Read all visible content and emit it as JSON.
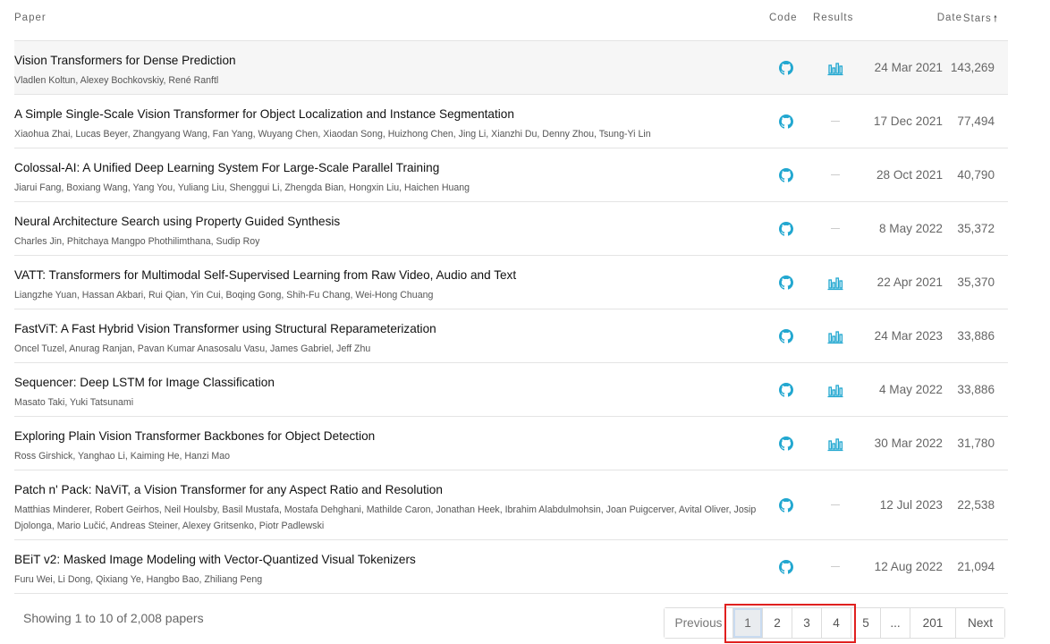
{
  "header": {
    "paper": "Paper",
    "code": "Code",
    "results": "Results",
    "date": "Date",
    "stars": "Stars"
  },
  "rows": [
    {
      "title": "Vision Transformers for Dense Prediction",
      "authors": "Vladlen Koltun, Alexey Bochkovskiy, René Ranftl",
      "has_results": true,
      "date": "24 Mar 2021",
      "stars": "143,269"
    },
    {
      "title": "A Simple Single-Scale Vision Transformer for Object Localization and Instance Segmentation",
      "authors": "Xiaohua Zhai, Lucas Beyer, Zhangyang Wang, Fan Yang, Wuyang Chen, Xiaodan Song, Huizhong Chen, Jing Li, Xianzhi Du, Denny Zhou, Tsung-Yi Lin",
      "has_results": false,
      "date": "17 Dec 2021",
      "stars": "77,494"
    },
    {
      "title": "Colossal-AI: A Unified Deep Learning System For Large-Scale Parallel Training",
      "authors": "Jiarui Fang, Boxiang Wang, Yang You, Yuliang Liu, Shenggui Li, Zhengda Bian, Hongxin Liu, Haichen Huang",
      "has_results": false,
      "date": "28 Oct 2021",
      "stars": "40,790"
    },
    {
      "title": "Neural Architecture Search using Property Guided Synthesis",
      "authors": "Charles Jin, Phitchaya Mangpo Phothilimthana, Sudip Roy",
      "has_results": false,
      "date": "8 May 2022",
      "stars": "35,372"
    },
    {
      "title": "VATT: Transformers for Multimodal Self-Supervised Learning from Raw Video, Audio and Text",
      "authors": "Liangzhe Yuan, Hassan Akbari, Rui Qian, Yin Cui, Boqing Gong, Shih-Fu Chang, Wei-Hong Chuang",
      "has_results": true,
      "date": "22 Apr 2021",
      "stars": "35,370"
    },
    {
      "title": "FastViT: A Fast Hybrid Vision Transformer using Structural Reparameterization",
      "authors": "Oncel Tuzel, Anurag Ranjan, Pavan Kumar Anasosalu Vasu, James Gabriel, Jeff Zhu",
      "has_results": true,
      "date": "24 Mar 2023",
      "stars": "33,886"
    },
    {
      "title": "Sequencer: Deep LSTM for Image Classification",
      "authors": "Masato Taki, Yuki Tatsunami",
      "has_results": true,
      "date": "4 May 2022",
      "stars": "33,886"
    },
    {
      "title": "Exploring Plain Vision Transformer Backbones for Object Detection",
      "authors": "Ross Girshick, Yanghao Li, Kaiming He, Hanzi Mao",
      "has_results": true,
      "date": "30 Mar 2022",
      "stars": "31,780"
    },
    {
      "title": "Patch n' Pack: NaViT, a Vision Transformer for any Aspect Ratio and Resolution",
      "authors": "Matthias Minderer, Robert Geirhos, Neil Houlsby, Basil Mustafa, Mostafa Dehghani, Mathilde Caron, Jonathan Heek, Ibrahim Alabdulmohsin, Joan Puigcerver, Avital Oliver, Josip Djolonga, Mario Lučić, Andreas Steiner, Alexey Gritsenko, Piotr Padlewski",
      "has_results": false,
      "date": "12 Jul 2023",
      "stars": "22,538"
    },
    {
      "title": "BEiT v2: Masked Image Modeling with Vector-Quantized Visual Tokenizers",
      "authors": "Furu Wei, Li Dong, Qixiang Ye, Hangbo Bao, Zhiliang Peng",
      "has_results": false,
      "date": "12 Aug 2022",
      "stars": "21,094"
    }
  ],
  "footer": {
    "showing_text": "Showing 1 to 10 of 2,008 papers"
  },
  "pagination": {
    "previous": "Previous",
    "pages": [
      "1",
      "2",
      "3",
      "4",
      "5"
    ],
    "ellipsis": "...",
    "last": "201",
    "next": "Next",
    "current": "1"
  },
  "colors": {
    "accent": "#21a7d0",
    "highlight": "#e0201f"
  },
  "icons": {
    "code": "github-icon",
    "results": "bar-chart-icon",
    "sort": "arrow-up-icon"
  }
}
